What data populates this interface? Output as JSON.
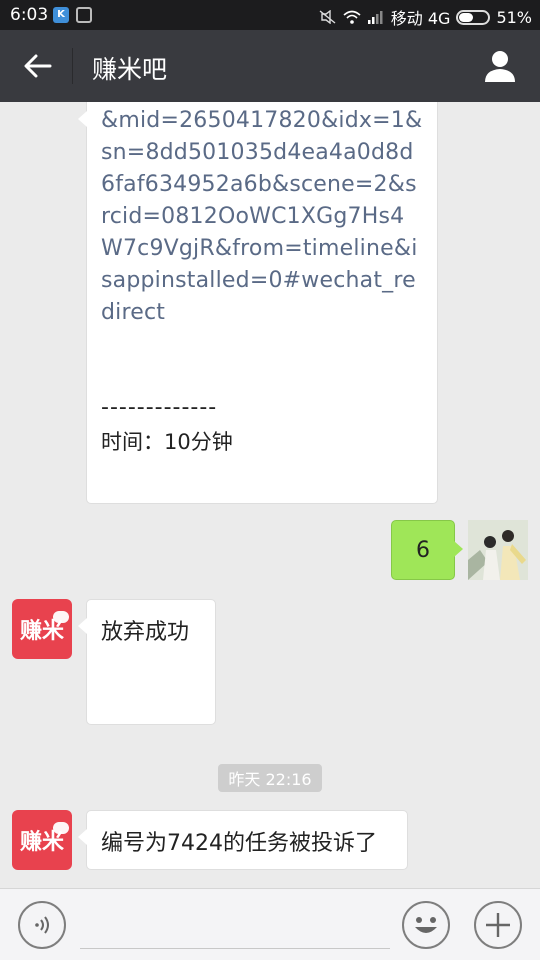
{
  "status_bar": {
    "time": "6:03",
    "carrier": "移动 4G",
    "battery": "51%",
    "battery_level": 0.51
  },
  "header": {
    "title": "赚米吧"
  },
  "messages": {
    "link_text": "&mid=2650417820&idx=1&sn=8dd501035d4ea4a0d8d6faf634952a6b&scene=2&srcid=0812OoWC1XGg7Hs4W7c9VgjR&from=timeline&isappinstalled=0#wechat_redirect",
    "separator": "-------------",
    "time_label": "时间：10分钟",
    "user_reply": "6",
    "abandon": "放弃成功",
    "date_chip": "昨天 22:16",
    "complaint": "编号为7424的任务被投诉了"
  },
  "avatar": {
    "bot_text": "赚米"
  },
  "input": {
    "placeholder": ""
  },
  "colors": {
    "nav_bg": "#393a3f",
    "bubble_sent": "#9fe658",
    "bot_avatar": "#e8424e",
    "link_text": "#5a6a86"
  }
}
